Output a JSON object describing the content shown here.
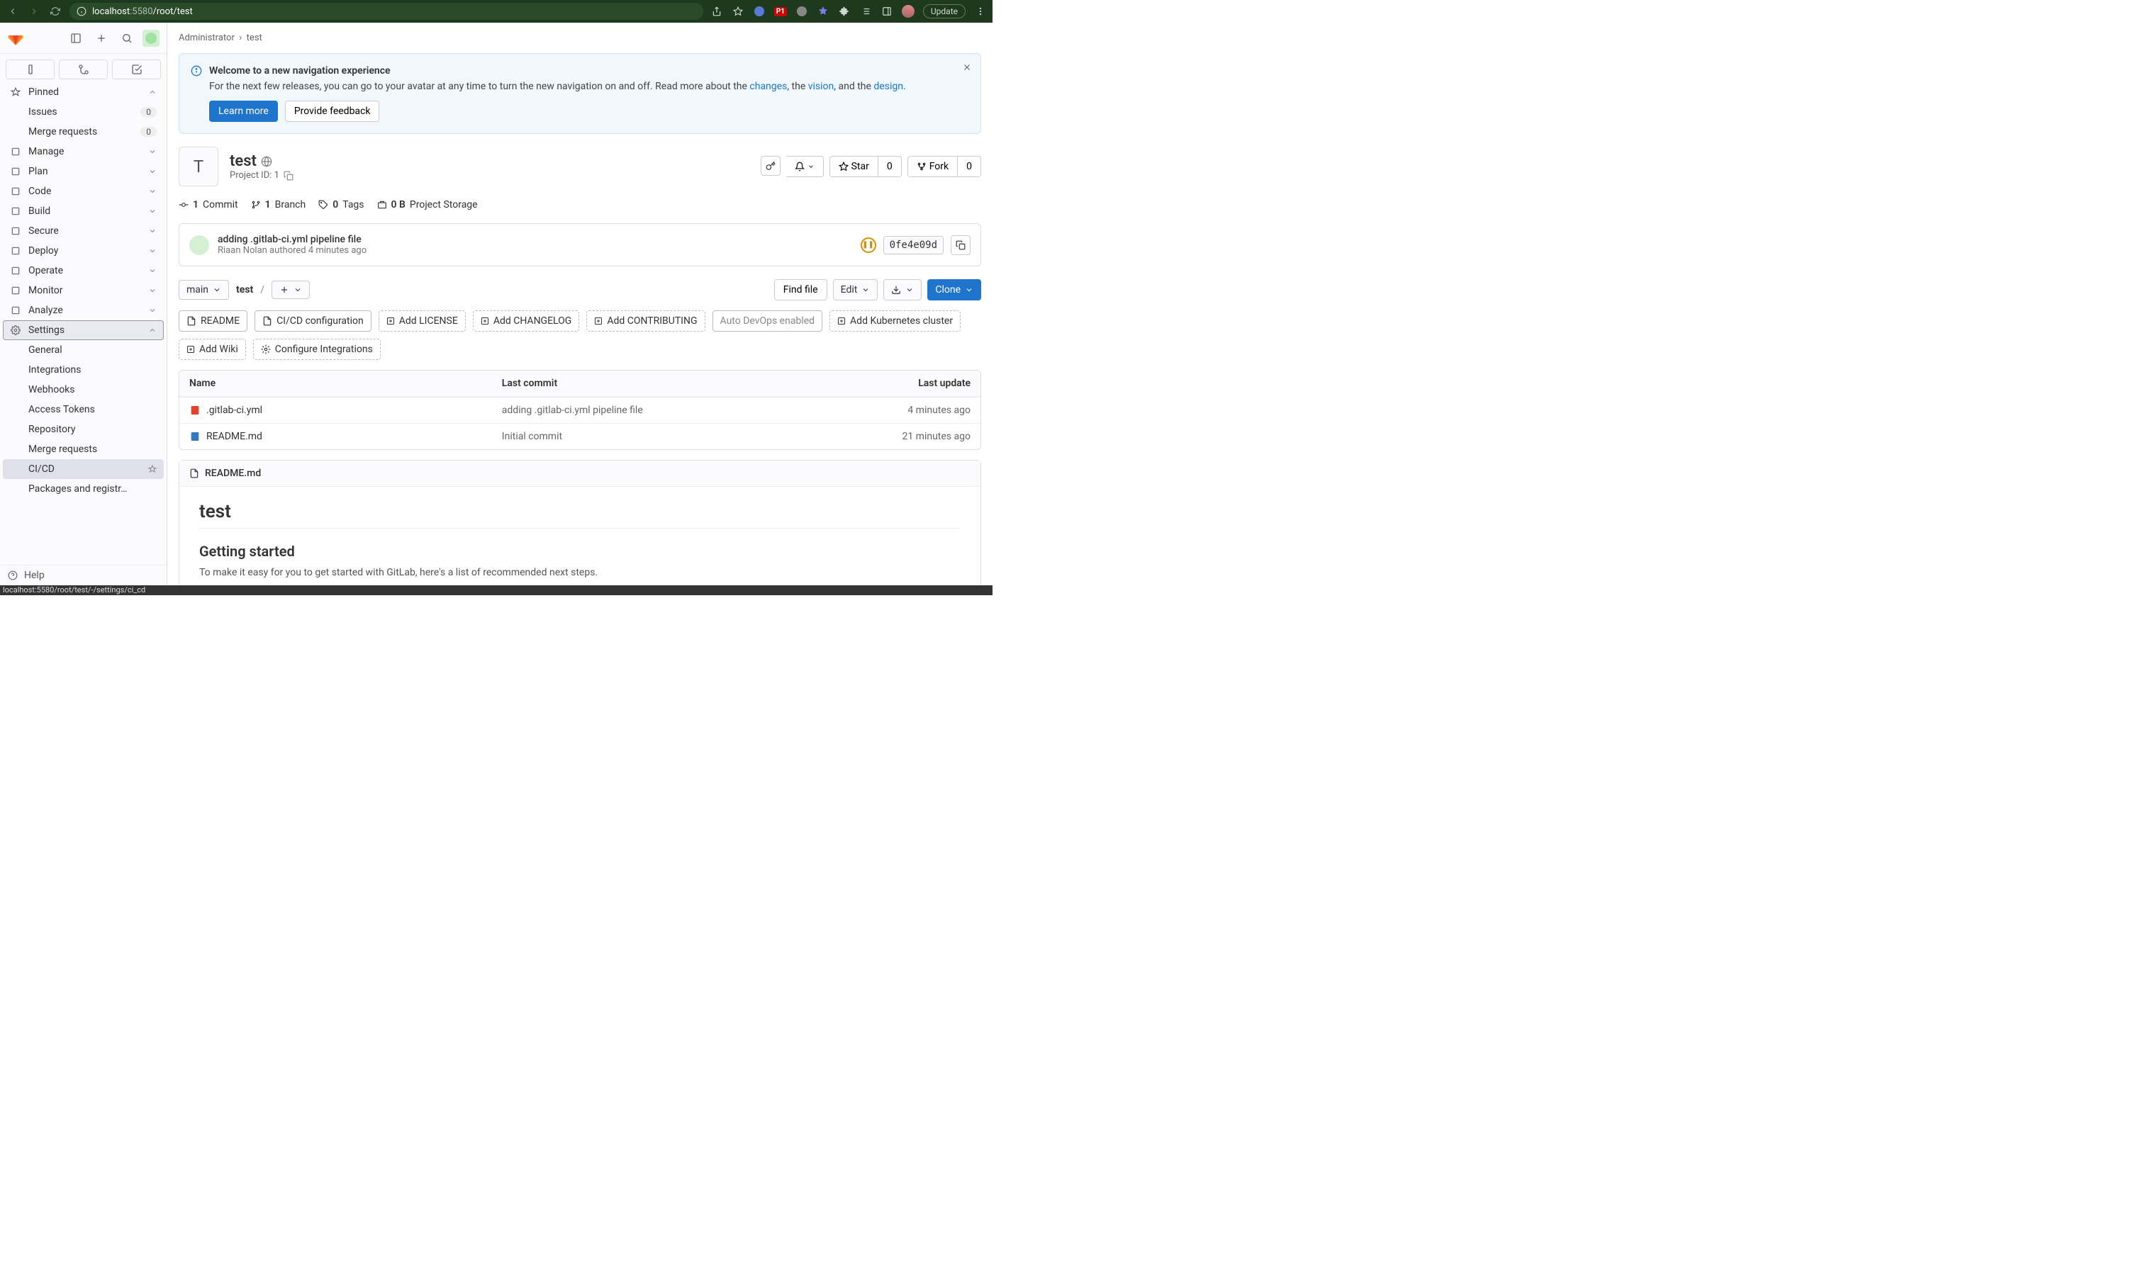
{
  "browser": {
    "url_host": "localhost",
    "url_port": ":5580",
    "url_path": "/root/test",
    "update_label": "Update",
    "p1": "P1",
    "status_bar": "localhost:5580/root/test/-/settings/ci_cd"
  },
  "sidebar": {
    "pinned_label": "Pinned",
    "pinned_items": [
      {
        "label": "Issues",
        "badge": "0"
      },
      {
        "label": "Merge requests",
        "badge": "0"
      }
    ],
    "groups": [
      {
        "label": "Manage"
      },
      {
        "label": "Plan"
      },
      {
        "label": "Code"
      },
      {
        "label": "Build"
      },
      {
        "label": "Secure"
      },
      {
        "label": "Deploy"
      },
      {
        "label": "Operate"
      },
      {
        "label": "Monitor"
      },
      {
        "label": "Analyze"
      }
    ],
    "settings_label": "Settings",
    "settings_items": [
      "General",
      "Integrations",
      "Webhooks",
      "Access Tokens",
      "Repository",
      "Merge requests",
      "CI/CD",
      "Packages and registr…"
    ],
    "help_label": "Help"
  },
  "crumb": {
    "admin": "Administrator",
    "project": "test"
  },
  "banner": {
    "title": "Welcome to a new navigation experience",
    "text_pre": "For the next few releases, you can go to your avatar at any time to turn the new navigation on and off. Read more about the ",
    "link1": "changes",
    "mid1": ", the ",
    "link2": "vision",
    "mid2": ", and the ",
    "link3": "design",
    "tail": ".",
    "learn_more": "Learn more",
    "feedback": "Provide feedback"
  },
  "project": {
    "avatar_letter": "T",
    "name": "test",
    "id_label": "Project ID: 1",
    "star_label": "Star",
    "star_count": "0",
    "fork_label": "Fork",
    "fork_count": "0"
  },
  "stats": {
    "commits_n": "1",
    "commits_l": "Commit",
    "branches_n": "1",
    "branches_l": "Branch",
    "tags_n": "0",
    "tags_l": "Tags",
    "storage_n": "0 B",
    "storage_l": "Project Storage"
  },
  "last_commit": {
    "title": "adding .gitlab-ci.yml pipeline file",
    "author": "Riaan Nolan authored 4 minutes ago",
    "sha": "0fe4e09d"
  },
  "filebar": {
    "branch": "main",
    "path": "test",
    "sep": "/",
    "find": "Find file",
    "edit": "Edit",
    "clone": "Clone"
  },
  "quick": {
    "readme": "README",
    "cicd": "CI/CD configuration",
    "license": "Add LICENSE",
    "changelog": "Add CHANGELOG",
    "contributing": "Add CONTRIBUTING",
    "devops": "Auto DevOps enabled",
    "k8s": "Add Kubernetes cluster",
    "wiki": "Add Wiki",
    "integ": "Configure Integrations"
  },
  "files": {
    "h_name": "Name",
    "h_commit": "Last commit",
    "h_update": "Last update",
    "rows": [
      {
        "name": ".gitlab-ci.yml",
        "commit": "adding .gitlab-ci.yml pipeline file",
        "update": "4 minutes ago",
        "icon": "gitlab"
      },
      {
        "name": "README.md",
        "commit": "Initial commit",
        "update": "21 minutes ago",
        "icon": "md"
      }
    ]
  },
  "readme": {
    "filename": "README.md",
    "h1": "test",
    "h2": "Getting started",
    "p": "To make it easy for you to get started with GitLab, here's a list of recommended next steps."
  }
}
